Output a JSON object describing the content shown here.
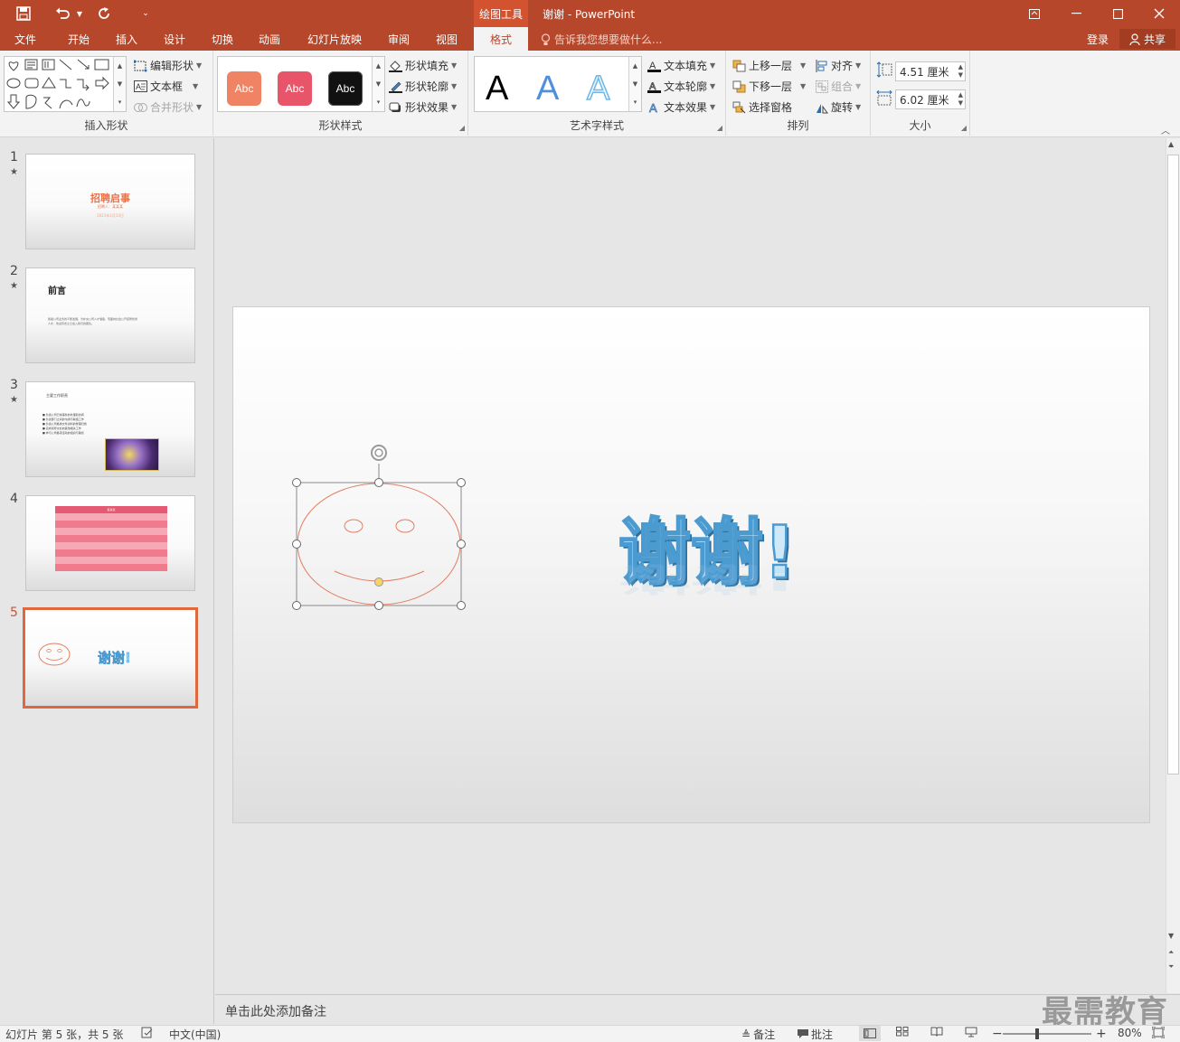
{
  "titlebar": {
    "context_tools": "绘图工具",
    "doc_title": "谢谢 - PowerPoint",
    "qat": [
      "save-icon",
      "undo-icon",
      "redo-icon",
      "customize-icon"
    ]
  },
  "tabs": [
    {
      "label": "文件"
    },
    {
      "label": "开始"
    },
    {
      "label": "插入"
    },
    {
      "label": "设计"
    },
    {
      "label": "切换"
    },
    {
      "label": "动画"
    },
    {
      "label": "幻灯片放映"
    },
    {
      "label": "审阅"
    },
    {
      "label": "视图"
    },
    {
      "label": "格式"
    }
  ],
  "tellme": "告诉我您想要做什么...",
  "account": {
    "login": "登录",
    "share": "共享"
  },
  "ribbon": {
    "insert_shapes": {
      "label": "插入形状",
      "edit_shape": "编辑形状",
      "text_box": "文本框",
      "merge_shapes": "合并形状"
    },
    "shape_styles": {
      "label": "形状样式",
      "swatches": [
        {
          "text": "Abc",
          "color": "#ef8363"
        },
        {
          "text": "Abc",
          "color": "#e8556a"
        },
        {
          "text": "Abc",
          "color": "#111111"
        }
      ],
      "fill": "形状填充",
      "outline": "形状轮廓",
      "effects": "形状效果"
    },
    "wordart_styles": {
      "label": "艺术字样式",
      "samples": [
        {
          "text": "A",
          "color": "#000000"
        },
        {
          "text": "A",
          "color": "#4f8fe0"
        },
        {
          "text": "A",
          "color": "#8ec9ee"
        }
      ],
      "text_fill": "文本填充",
      "text_outline": "文本轮廓",
      "text_effects": "文本效果"
    },
    "arrange": {
      "label": "排列",
      "bring_forward": "上移一层",
      "send_backward": "下移一层",
      "selection_pane": "选择窗格",
      "align": "对齐",
      "group": "组合",
      "rotate": "旋转"
    },
    "size": {
      "label": "大小",
      "height": "4.51 厘米",
      "width": "6.02 厘米"
    }
  },
  "thumbnails": [
    {
      "num": "1",
      "star": "★",
      "title": "招聘启事",
      "sub1": "招聘人：某某某",
      "sub2": "2021年1月10日"
    },
    {
      "num": "2",
      "star": "★",
      "title": "前言",
      "body": "随着公司业务的不断发展，为补充公司人才储备，现面向社会公开招聘优秀人才，欢迎有志之士加入我们的团队。"
    },
    {
      "num": "3",
      "star": "★",
      "title": "主要工作职责",
      "bullets": [
        "负责公司日常事务的处理和协调",
        "负责部门之间的沟通与联络工作",
        "负责公司各类文件资料的整理归档",
        "完成领导交办的其他相关工作",
        "参与公司各项活动的组织与策划"
      ]
    },
    {
      "num": "4",
      "table_title": "薪资表"
    },
    {
      "num": "5",
      "text": "谢谢!"
    }
  ],
  "slide": {
    "text": "谢谢!"
  },
  "notes_placeholder": "单击此处添加备注",
  "status": {
    "slide_info": "幻灯片 第 5 张，共 5 张",
    "language": "中文(中国)",
    "notes": "备注",
    "comments": "批注",
    "zoom": "80%",
    "zoom_fraction": 0.8
  },
  "watermark": "最需教育",
  "colors": {
    "accent": "#b7472a",
    "context_tab": "#d35230",
    "selected_thumb": "#e0683f",
    "smiley_line": "#e27d60",
    "wordart": "#8ec9ee"
  }
}
